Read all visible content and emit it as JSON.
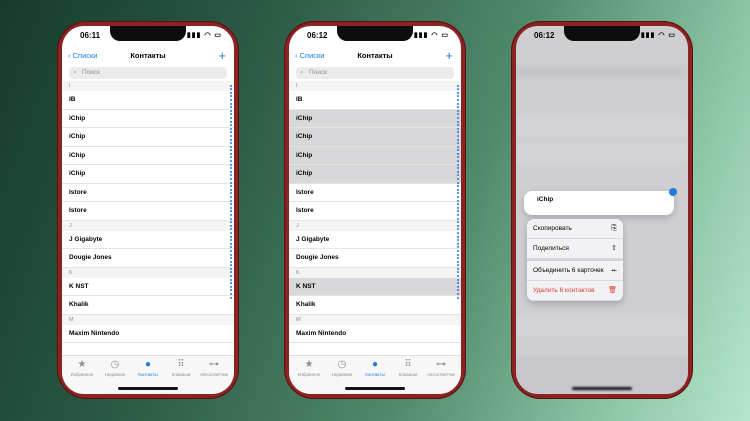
{
  "phones": [
    {
      "time": "06:11",
      "nav": {
        "back_label": "Списки",
        "title": "Контакты",
        "add_icon": "+"
      },
      "search_placeholder": "Поиск",
      "list": [
        {
          "type": "section",
          "label": "I"
        },
        {
          "type": "row",
          "label": "IB",
          "selected": false
        },
        {
          "type": "row",
          "label": "iChip",
          "selected": false
        },
        {
          "type": "row",
          "label": "iChip",
          "selected": false
        },
        {
          "type": "row",
          "label": "iChip",
          "selected": false
        },
        {
          "type": "row",
          "label": "iChip",
          "selected": false
        },
        {
          "type": "row",
          "label": "Istore",
          "selected": false
        },
        {
          "type": "row",
          "label": "Istore",
          "selected": false
        },
        {
          "type": "section",
          "label": "J"
        },
        {
          "type": "row",
          "label": "J Gigabyte",
          "selected": false
        },
        {
          "type": "row",
          "label": "Dougie Jones",
          "selected": false
        },
        {
          "type": "section",
          "label": "K"
        },
        {
          "type": "row",
          "label": "K NST",
          "selected": false
        },
        {
          "type": "row",
          "label": "Khalik",
          "selected": false
        },
        {
          "type": "section",
          "label": "M"
        },
        {
          "type": "row",
          "label": "Maxim Nintendo",
          "selected": false
        }
      ]
    },
    {
      "time": "06:12",
      "nav": {
        "back_label": "Списки",
        "title": "Контакты",
        "add_icon": "+"
      },
      "search_placeholder": "Поиск",
      "list": [
        {
          "type": "section",
          "label": "I"
        },
        {
          "type": "row",
          "label": "IB",
          "selected": false
        },
        {
          "type": "row",
          "label": "iChip",
          "selected": true
        },
        {
          "type": "row",
          "label": "iChip",
          "selected": true
        },
        {
          "type": "row",
          "label": "iChip",
          "selected": true
        },
        {
          "type": "row",
          "label": "iChip",
          "selected": true
        },
        {
          "type": "row",
          "label": "Istore",
          "selected": false
        },
        {
          "type": "row",
          "label": "Istore",
          "selected": false
        },
        {
          "type": "section",
          "label": "J"
        },
        {
          "type": "row",
          "label": "J Gigabyte",
          "selected": false
        },
        {
          "type": "row",
          "label": "Dougie Jones",
          "selected": false
        },
        {
          "type": "section",
          "label": "K"
        },
        {
          "type": "row",
          "label": "K NST",
          "selected": true
        },
        {
          "type": "row",
          "label": "Khalik",
          "selected": false
        },
        {
          "type": "section",
          "label": "M"
        },
        {
          "type": "row",
          "label": "Maxim Nintendo",
          "selected": false
        }
      ]
    },
    {
      "time": "06:12",
      "preview_name": "iChip",
      "menu": [
        {
          "label": "Скопировать",
          "icon": "copy-icon",
          "glyph": "⎘",
          "danger": false
        },
        {
          "label": "Поделиться",
          "icon": "share-icon",
          "glyph": "⇧",
          "danger": false
        },
        {
          "label": "Объединить 6 карточек",
          "icon": "merge-icon",
          "glyph": "⤝",
          "danger": false
        },
        {
          "label": "Удалить 6 контактов",
          "icon": "trash-icon",
          "glyph": "🗑",
          "danger": true
        }
      ]
    }
  ],
  "tabbar": [
    {
      "label": "Избранное",
      "icon": "star-icon",
      "glyph": "★",
      "active": false
    },
    {
      "label": "Недавние",
      "icon": "clock-icon",
      "glyph": "◷",
      "active": false
    },
    {
      "label": "Контакты",
      "icon": "person-icon",
      "glyph": "●",
      "active": true
    },
    {
      "label": "Клавиши",
      "icon": "keypad-icon",
      "glyph": "⠿",
      "active": false
    },
    {
      "label": "Автоответчик",
      "icon": "voicemail-icon",
      "glyph": "⊶",
      "active": false
    }
  ],
  "status_icons": "▮▮▮ ◠ ▭",
  "colors": {
    "accent": "#1f7ae0",
    "danger": "#e0382e",
    "phone_frame": "#8b2323"
  }
}
